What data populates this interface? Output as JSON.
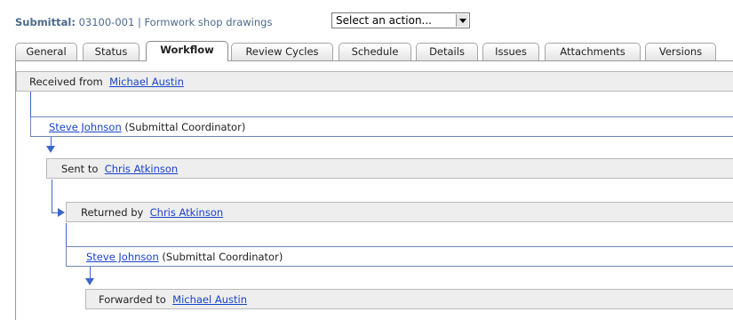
{
  "header": {
    "label": "Submittal",
    "id": "03100-001",
    "separator": "|",
    "name": "Formwork shop drawings",
    "action_select": "Select an action..."
  },
  "tabs": [
    {
      "label": "General"
    },
    {
      "label": "Status"
    },
    {
      "label": "Workflow",
      "active": true
    },
    {
      "label": "Review Cycles"
    },
    {
      "label": "Schedule"
    },
    {
      "label": "Details"
    },
    {
      "label": "Issues"
    },
    {
      "label": "Attachments"
    },
    {
      "label": "Versions"
    }
  ],
  "workflow": [
    {
      "prefix": "Received from",
      "person": "Michael Austin",
      "role": ""
    },
    {
      "prefix": "",
      "person": "Steve Johnson",
      "role": "(Submittal Coordinator)"
    },
    {
      "prefix": "Sent to",
      "person": "Chris Atkinson",
      "role": ""
    },
    {
      "prefix": "Returned by",
      "person": "Chris Atkinson",
      "role": ""
    },
    {
      "prefix": "",
      "person": "Steve Johnson",
      "role": "(Submittal Coordinator)"
    },
    {
      "prefix": "Forwarded to",
      "person": "Michael Austin",
      "role": ""
    }
  ],
  "colors": {
    "accent": "#3d67c6",
    "title": "#4d6a8c",
    "link": "#1a43c8"
  }
}
